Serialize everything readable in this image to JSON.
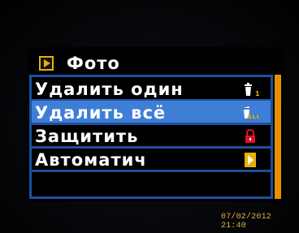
{
  "menu": {
    "title": "Фото",
    "items": [
      {
        "label": "Удалить один",
        "icon": "delete-one-icon",
        "selected": false
      },
      {
        "label": "Удалить всё",
        "icon": "delete-all-icon",
        "selected": true
      },
      {
        "label": "Защитить",
        "icon": "lock-icon",
        "selected": false
      },
      {
        "label": "Автоматич",
        "icon": "play-arrow-icon",
        "selected": false
      }
    ],
    "delete_one_icon_text": "1",
    "delete_all_icon_text": "ALL"
  },
  "timestamp": "07/02/2012 21:40",
  "colors": {
    "menu_border": "#1f4f9e",
    "selected_bg": "#3f7ed6",
    "accent_orange": "#e88f00",
    "icon_yellow": "#e8b000",
    "lock_red": "#e0102a",
    "timestamp": "#e8b040"
  }
}
